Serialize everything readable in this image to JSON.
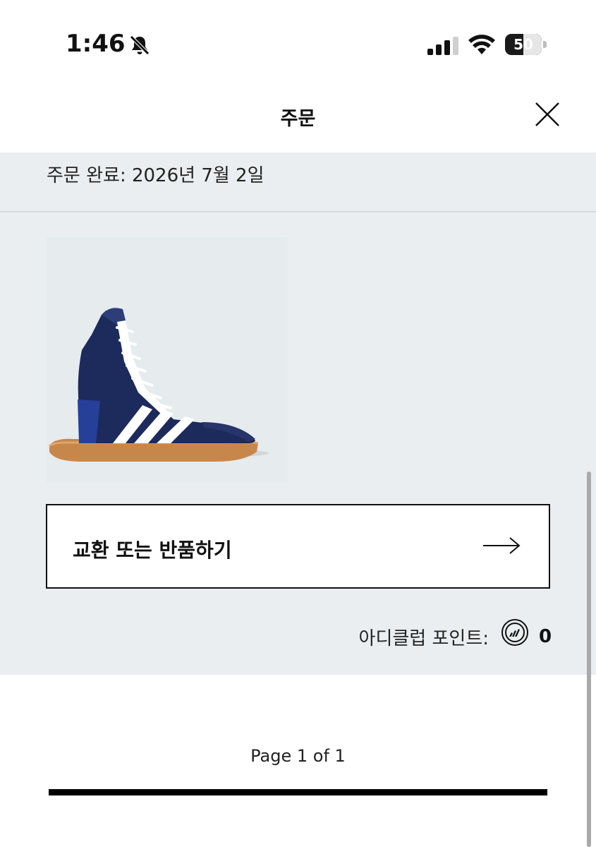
{
  "status_bar": {
    "time": "1:46",
    "battery": "50",
    "icons": [
      "bell-slash-icon",
      "cellular-signal-icon",
      "wifi-icon",
      "battery-icon"
    ]
  },
  "header": {
    "title": "주문",
    "close_icon": "close-icon"
  },
  "order": {
    "completed_label": "주문 완료: 2026년 7월 2일",
    "product_image": "boxing-shoe-navy-white-stripes"
  },
  "actions": {
    "exchange_return_label": "교환 또는 반품하기",
    "arrow_icon": "arrow-right-icon"
  },
  "points": {
    "label": "아디클럽 포인트:",
    "icon": "adiclub-points-icon",
    "value": "0"
  },
  "pagination": {
    "label": "Page 1 of 1"
  },
  "colors": {
    "panel_bg": "#eaeef1",
    "shoe_navy": "#1c2a5c",
    "gum_sole": "#c8874a"
  }
}
